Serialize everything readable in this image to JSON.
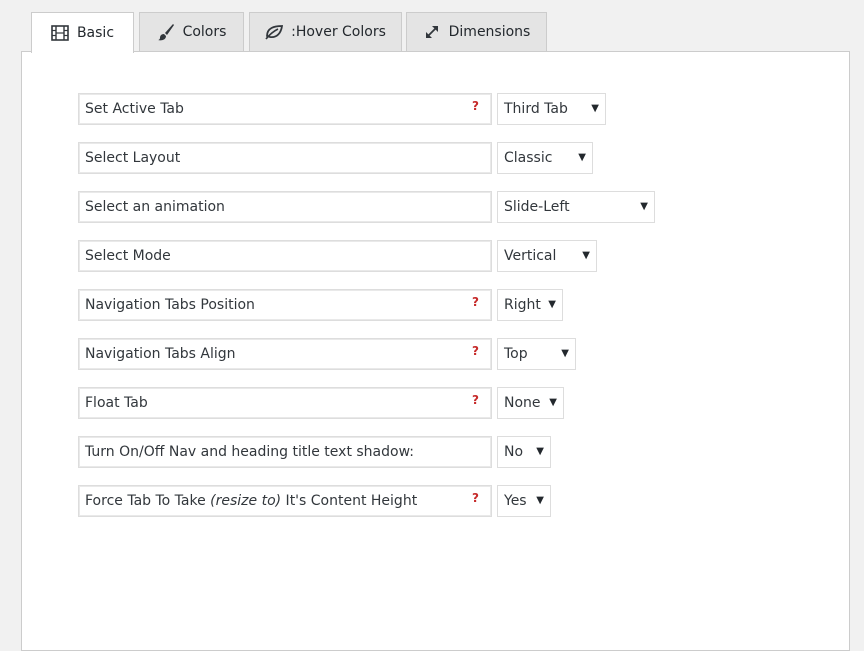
{
  "tabs": [
    {
      "label": "Basic",
      "icon": "film-icon",
      "active": true
    },
    {
      "label": "Colors",
      "icon": "paint-brush-icon",
      "active": false
    },
    {
      "label": ":Hover Colors",
      "icon": "leaf-icon",
      "active": false
    },
    {
      "label": "Dimensions",
      "icon": "expand-arrows-icon",
      "active": false
    }
  ],
  "help_glyph": "?",
  "caret_glyph": "▼",
  "rows": [
    {
      "label": "Set Active Tab",
      "has_help": true,
      "value": "Third Tab"
    },
    {
      "label": "Select Layout",
      "has_help": false,
      "value": "Classic"
    },
    {
      "label": "Select an animation",
      "has_help": false,
      "value": "Slide-Left"
    },
    {
      "label": "Select Mode",
      "has_help": false,
      "value": "Vertical"
    },
    {
      "label": "Navigation Tabs Position",
      "has_help": true,
      "value": "Right"
    },
    {
      "label": "Navigation Tabs Align",
      "has_help": true,
      "value": "Top"
    },
    {
      "label": "Float Tab",
      "has_help": true,
      "value": "None"
    },
    {
      "label": "Turn On/Off Nav and heading title text shadow:",
      "has_help": false,
      "value": "No"
    },
    {
      "label_prefix": "Force Tab To Take ",
      "label_italic": "(resize to)",
      "label_suffix": " It's Content Height",
      "has_help": true,
      "value": "Yes"
    }
  ],
  "colors": {
    "help": "#c62b2b",
    "active_tab": "#ffffff",
    "inactive_tab": "#e4e4e4",
    "border": "#cccccc"
  }
}
